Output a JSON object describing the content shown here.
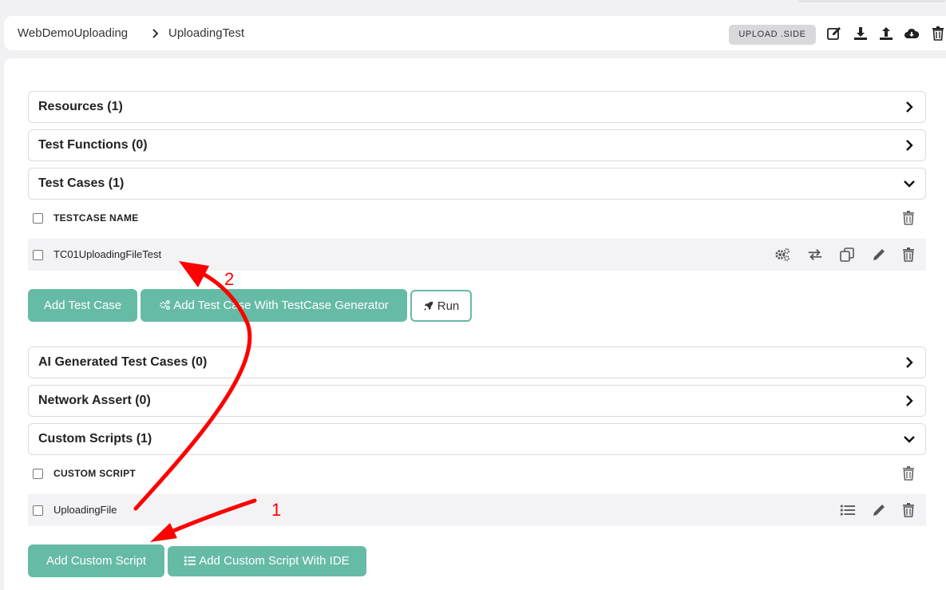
{
  "header": {
    "breadcrumb": [
      "WebDemoUploading",
      "UploadingTest"
    ],
    "upload_side_label": "UPLOAD .SIDE",
    "icons": [
      "edit-icon",
      "download-icon",
      "upload-icon",
      "cloud-download-icon",
      "trash-icon"
    ]
  },
  "sections": {
    "resources": "Resources (1)",
    "test_functions": "Test Functions (0)",
    "test_cases": "Test Cases (1)",
    "ai_generated": "AI Generated Test Cases (0)",
    "network_assert": "Network Assert (0)",
    "custom_scripts": "Custom Scripts (1)"
  },
  "test_cases_table": {
    "header": "TESTCASE NAME",
    "rows": [
      "TC01UploadingFileTest"
    ]
  },
  "test_case_buttons": {
    "add": "Add Test Case",
    "add_generator": "Add Test Case With TestCase Generator",
    "run": "Run"
  },
  "custom_scripts_table": {
    "header": "CUSTOM SCRIPT",
    "rows": [
      "UploadingFile"
    ]
  },
  "custom_script_buttons": {
    "add": "Add Custom Script",
    "add_ide": "Add Custom Script With IDE"
  },
  "annotations": {
    "step1": "1",
    "step2": "2",
    "color": "#ff0000"
  },
  "colors": {
    "accent": "#66bba6",
    "background": "#f1f1f4"
  }
}
